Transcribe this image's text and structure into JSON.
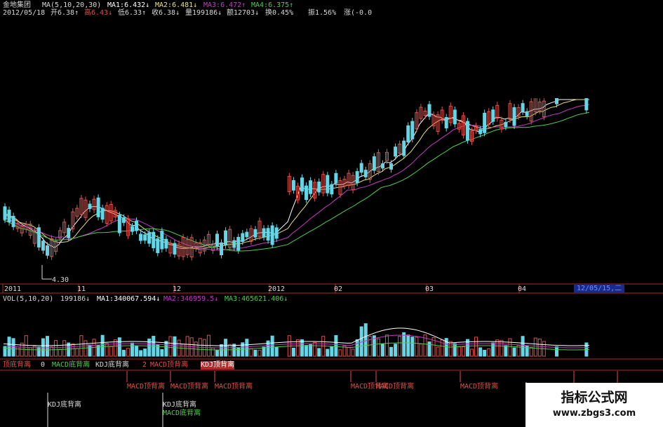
{
  "header": {
    "stock_name": "金地集团",
    "ma_params": "MA(5,10,20,30)",
    "ma1": "MA1:6.432↓",
    "ma2": "MA2:6.481↓",
    "ma3": "MA3:6.472↑",
    "ma4": "MA4:6.375↑",
    "date": "2012/05/18",
    "open": "开6.38↑",
    "high": "高6.43↓",
    "low": "低6.33↑",
    "close": "收6.38↓",
    "volume": "量199186↓",
    "amount": "额12703↓",
    "turnover": "换0.45%",
    "amplitude": "振1.56%",
    "change": "涨(-0.0"
  },
  "price_chart": {
    "low_label": "4.30"
  },
  "date_axis": {
    "labels": [
      "2011",
      "11",
      "12",
      "2012",
      "02",
      "03",
      "04"
    ],
    "current_date": "12/05/15,二"
  },
  "volume_panel": {
    "params": "VOL(5,10,20)",
    "vol": "199186↓",
    "ma1": "MA1:340067.594↓",
    "ma2": "MA2:346959.5↓",
    "ma3": "MA3:465621.406↓"
  },
  "indicator_panel": {
    "title": "顶底背离",
    "value": "0",
    "macd_bottom": "MACD底背离",
    "kdj_bottom": "KDJ底背离",
    "value2": "2",
    "macd_top": "MACD顶背离",
    "kdj_top": "KDJ顶背离",
    "signals": [
      "MACD顶背离",
      "MACD顶背离",
      "MACD顶背离",
      "MACD顶背离",
      "MACD顶背离",
      "MACD顶背离"
    ],
    "kdj_signal1": "KDJ底背离",
    "kdj_signal2": "KDJ底背离",
    "macd_signal_low": "MACD底背离"
  },
  "colors": {
    "bg": "#000000",
    "up": "#e0514a",
    "down": "#64d6e6",
    "ma_white": "#ffffff",
    "ma_yellow": "#e9e37a",
    "ma_magenta": "#c33cc3",
    "ma_green": "#4fce4f",
    "axis": "#b02a2a"
  },
  "watermark": {
    "brand": "指标公式网",
    "url": "www.zbgs3.com"
  }
}
